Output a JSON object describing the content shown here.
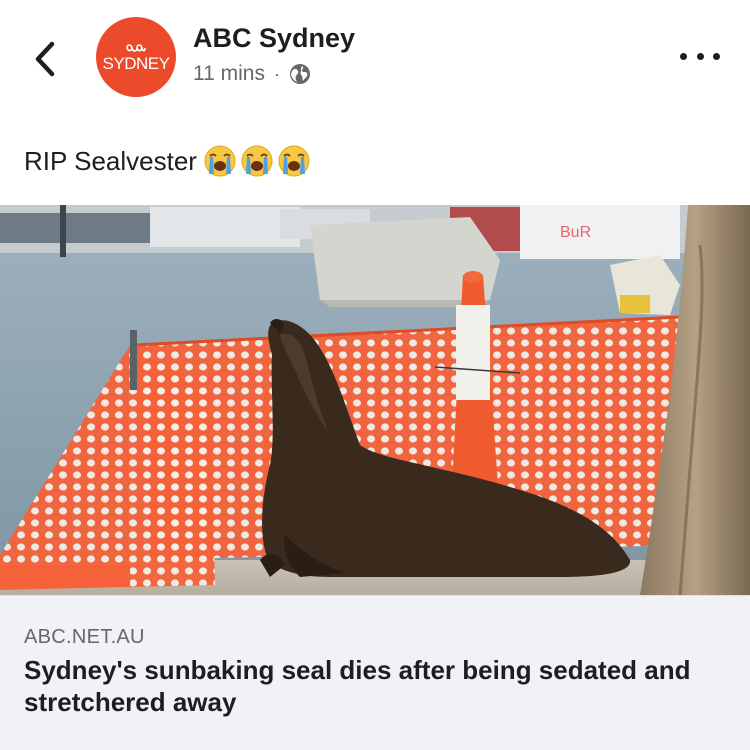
{
  "header": {
    "back_icon": "chevron-left-icon",
    "avatar": {
      "logo": "abc-logo",
      "text": "SYDNEY",
      "color": "#ec4b2b"
    },
    "page_name": "ABC Sydney",
    "timestamp": "11 mins",
    "separator": "·",
    "privacy_icon": "globe-icon",
    "more_icon": "more-horizontal-icon"
  },
  "post": {
    "text": "RIP Sealvester",
    "emojis": [
      "loudly-crying-face-icon",
      "loudly-crying-face-icon",
      "loudly-crying-face-icon"
    ]
  },
  "link_card": {
    "domain": "ABC.NET.AU",
    "title": "Sydney's sunbaking seal dies after being sedated and stretchered away"
  },
  "colors": {
    "text_primary": "#1c1e21",
    "text_secondary": "#65676b",
    "card_background": "#f0f2f5",
    "fence_orange": "#f0582c"
  }
}
